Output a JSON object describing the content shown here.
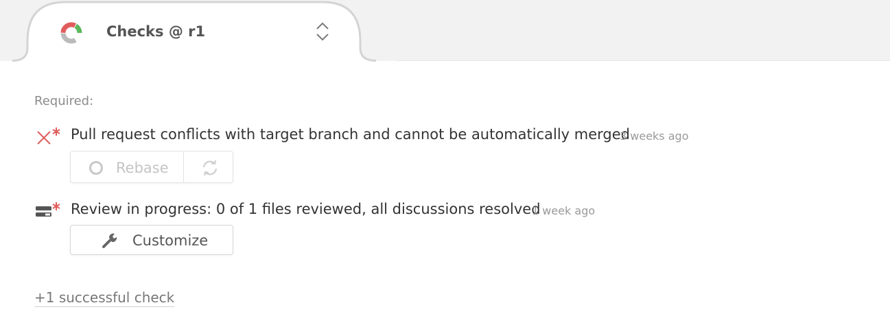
{
  "tab": {
    "title": "Checks @ r1",
    "icon": "check-status-donut-icon",
    "toggle_icon": "chevron-up-down-icon"
  },
  "section": {
    "required_label": "Required:"
  },
  "checks": [
    {
      "icon": "failed-required-x-icon",
      "text": "Pull request conflicts with target branch and cannot be automatically merged",
      "time": "3 weeks ago",
      "actions": {
        "rebase_label": "Rebase",
        "rebase_icon": "circle-icon",
        "refresh_icon": "refresh-icon"
      }
    },
    {
      "icon": "review-progress-icon",
      "text": "Review in progress: 0 of 1 files reviewed, all discussions resolved",
      "time": "1 week ago",
      "actions": {
        "customize_label": "Customize",
        "customize_icon": "wrench-icon"
      }
    }
  ],
  "footer": {
    "successful_link": "+1 successful check"
  },
  "colors": {
    "success": "#5cb85c",
    "failure": "#e05d5d",
    "neutral": "#bbbbbb",
    "required_mark": "#e05d5d"
  }
}
